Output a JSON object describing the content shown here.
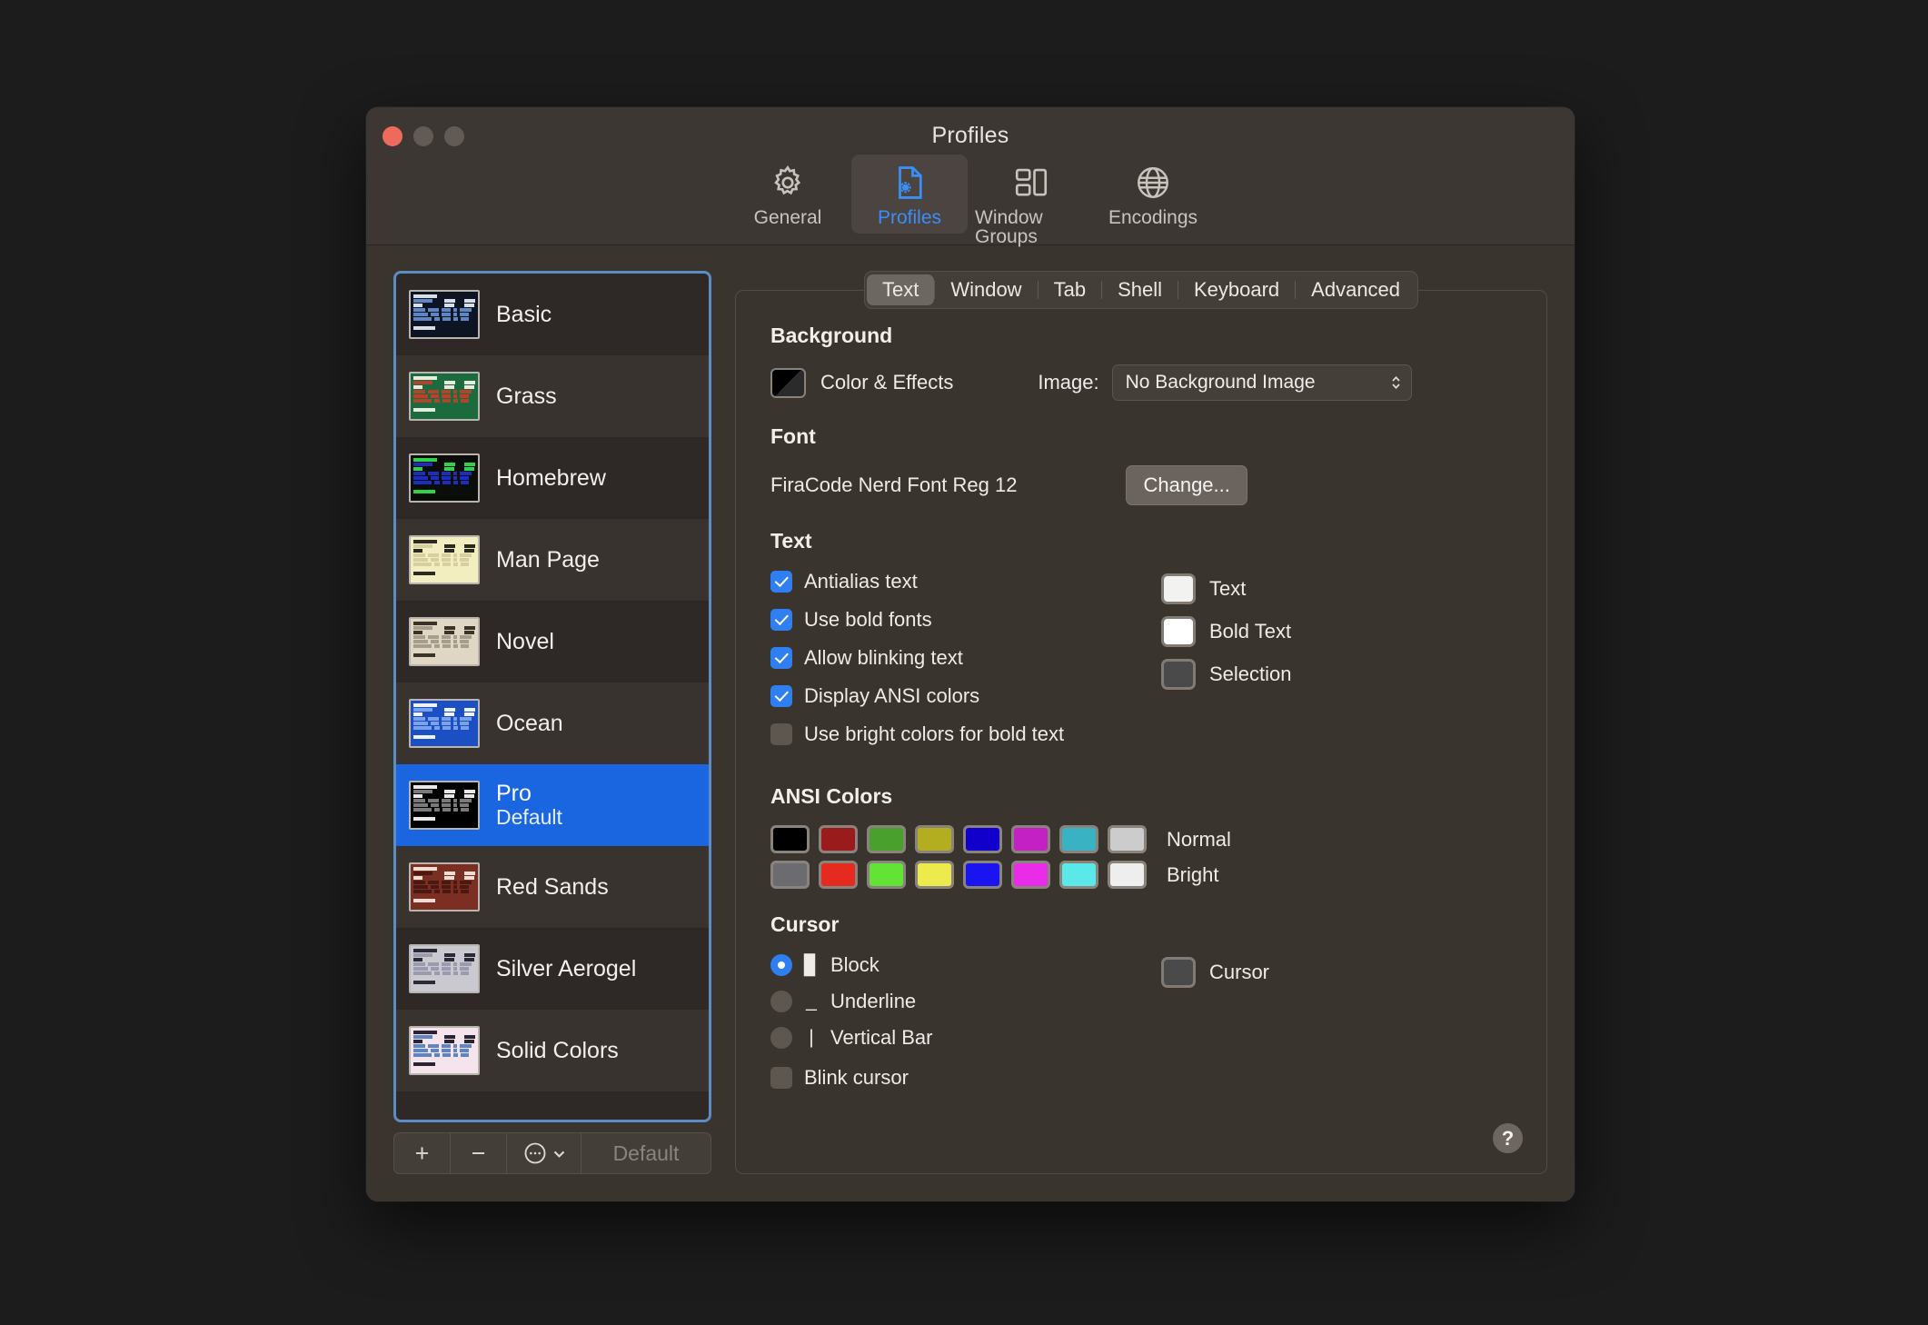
{
  "window": {
    "title": "Profiles",
    "traffic_lights": [
      "close",
      "minimize",
      "maximize"
    ]
  },
  "toolbar": {
    "items": [
      {
        "label": "General",
        "icon": "gear-icon",
        "active": false
      },
      {
        "label": "Profiles",
        "icon": "document-gear-icon",
        "active": true
      },
      {
        "label": "Window Groups",
        "icon": "window-groups-icon",
        "active": false
      },
      {
        "label": "Encodings",
        "icon": "globe-icon",
        "active": false
      }
    ]
  },
  "sidebar": {
    "profiles": [
      {
        "name": "Basic",
        "subtitle": "",
        "selected": false,
        "thumb_bg": "#0d1422",
        "thumb_fg": "#d8dde6",
        "thumb_hl": "#5f86c4"
      },
      {
        "name": "Grass",
        "subtitle": "",
        "selected": false,
        "thumb_bg": "#1c6b3e",
        "thumb_fg": "#e4ebdf",
        "thumb_hl": "#b8412c"
      },
      {
        "name": "Homebrew",
        "subtitle": "",
        "selected": false,
        "thumb_bg": "#0a0d0a",
        "thumb_fg": "#33d14a",
        "thumb_hl": "#1b2ec0"
      },
      {
        "name": "Man Page",
        "subtitle": "",
        "selected": false,
        "thumb_bg": "#f2eec0",
        "thumb_fg": "#2a2a22",
        "thumb_hl": "#d6d0a0"
      },
      {
        "name": "Novel",
        "subtitle": "",
        "selected": false,
        "thumb_bg": "#dfd6c3",
        "thumb_fg": "#3b3228",
        "thumb_hl": "#a79d8c"
      },
      {
        "name": "Ocean",
        "subtitle": "",
        "selected": false,
        "thumb_bg": "#1d4fc4",
        "thumb_fg": "#eef2fb",
        "thumb_hl": "#7aa2e8"
      },
      {
        "name": "Pro",
        "subtitle": "Default",
        "selected": true,
        "thumb_bg": "#000000",
        "thumb_fg": "#e8e8e8",
        "thumb_hl": "#7a7a7a"
      },
      {
        "name": "Red Sands",
        "subtitle": "",
        "selected": false,
        "thumb_bg": "#7a2f22",
        "thumb_fg": "#f0ddd4",
        "thumb_hl": "#4a1a12"
      },
      {
        "name": "Silver Aerogel",
        "subtitle": "",
        "selected": false,
        "thumb_bg": "#c9c9cf",
        "thumb_fg": "#2b2b33",
        "thumb_hl": "#9a9ab0"
      },
      {
        "name": "Solid Colors",
        "subtitle": "",
        "selected": false,
        "thumb_bg": "#f6e4ec",
        "thumb_fg": "#2a2430",
        "thumb_hl": "#5f86c4"
      }
    ],
    "toolbar": {
      "add_label": "+",
      "remove_label": "−",
      "actions_label": "···",
      "actions_chevron": "⌄",
      "default_label": "Default"
    }
  },
  "tabs": [
    {
      "label": "Text",
      "active": true
    },
    {
      "label": "Window",
      "active": false
    },
    {
      "label": "Tab",
      "active": false
    },
    {
      "label": "Shell",
      "active": false
    },
    {
      "label": "Keyboard",
      "active": false
    },
    {
      "label": "Advanced",
      "active": false
    }
  ],
  "background": {
    "title": "Background",
    "color_effects_label": "Color & Effects",
    "image_label": "Image:",
    "image_value": "No Background Image"
  },
  "font": {
    "title": "Font",
    "value": "FiraCode Nerd Font Reg 12",
    "change_label": "Change..."
  },
  "text": {
    "title": "Text",
    "checkboxes": [
      {
        "label": "Antialias text",
        "checked": true
      },
      {
        "label": "Use bold fonts",
        "checked": true
      },
      {
        "label": "Allow blinking text",
        "checked": true
      },
      {
        "label": "Display ANSI colors",
        "checked": true
      },
      {
        "label": "Use bright colors for bold text",
        "checked": false
      }
    ],
    "swatches": [
      {
        "label": "Text",
        "color": "#f2f2f0"
      },
      {
        "label": "Bold Text",
        "color": "#ffffff"
      },
      {
        "label": "Selection",
        "color": "#4a4a4a"
      }
    ]
  },
  "ansi": {
    "title": "ANSI Colors",
    "rows": [
      {
        "label": "Normal",
        "colors": [
          "#000000",
          "#991b1b",
          "#4aa02c",
          "#b3ae1f",
          "#1100cc",
          "#c421c4",
          "#39b3c4",
          "#cccccc"
        ]
      },
      {
        "label": "Bright",
        "colors": [
          "#6b6b70",
          "#e52b20",
          "#63e335",
          "#edea4e",
          "#1a14f0",
          "#e82ce8",
          "#5ae8e8",
          "#eeeeee"
        ]
      }
    ]
  },
  "cursor": {
    "title": "Cursor",
    "options": [
      {
        "label": "Block",
        "glyph": "▊",
        "selected": true
      },
      {
        "label": "Underline",
        "glyph": "_",
        "selected": false
      },
      {
        "label": "Vertical Bar",
        "glyph": "|",
        "selected": false
      }
    ],
    "blink": {
      "label": "Blink cursor",
      "checked": false
    },
    "swatch": {
      "label": "Cursor",
      "color": "#4a4a4a"
    }
  },
  "help": {
    "label": "?"
  },
  "colors": {
    "accent_blue": "#2f7ff0",
    "selection_blue": "#1a66e0",
    "focus_ring": "#5c8cc2",
    "window_bg": "#3a342f",
    "titlebar_bg": "#3d3733"
  }
}
